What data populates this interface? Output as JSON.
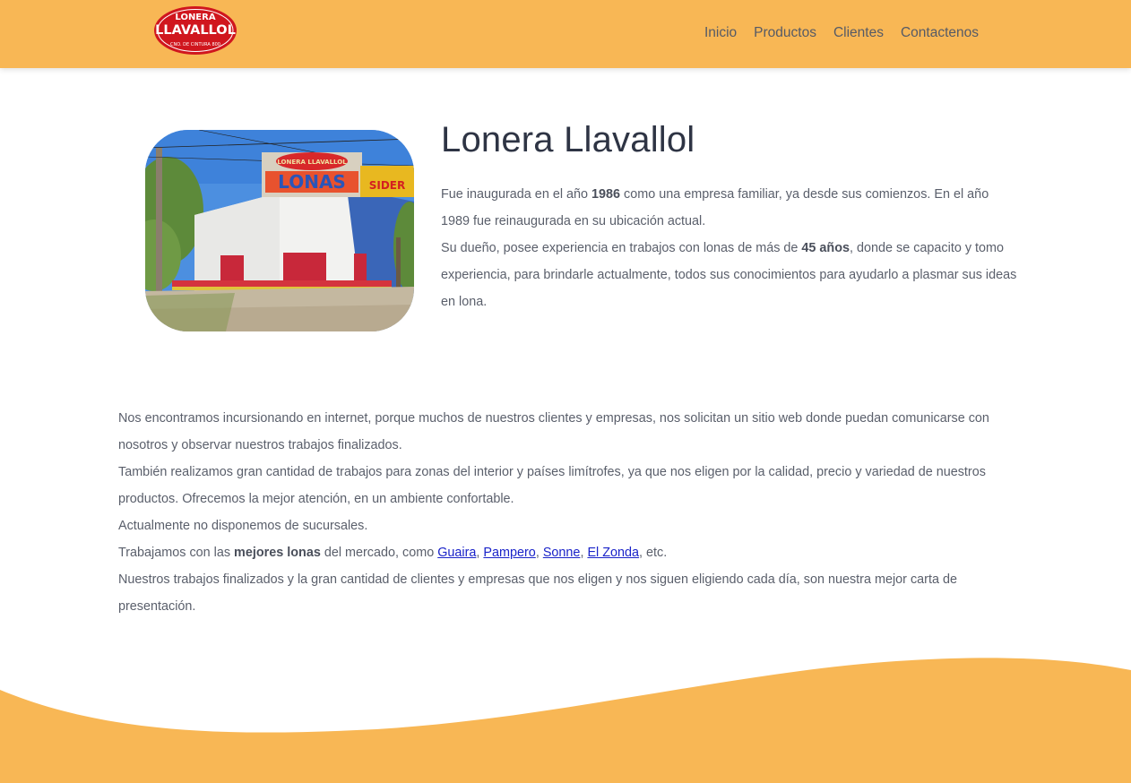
{
  "logo": {
    "line1": "LONERA",
    "line2": "LLAVALLOL",
    "line3": "CNO. DE CINTURA 800"
  },
  "nav": {
    "items": [
      "Inicio",
      "Productos",
      "Clientes",
      "Contactenos"
    ]
  },
  "photo": {
    "sign_text": "LONAS",
    "sign_top_text": "LONERA LLAVALLOL",
    "side_text": "SIDER"
  },
  "about": {
    "title": "Lonera Llavallol",
    "p1_a": "Fue inaugurada en el año ",
    "p1_b": "1986",
    "p1_c": " como una empresa familiar, ya desde sus comienzos. En el año 1989 fue reinaugurada en su ubicación actual.",
    "p2_a": "Su dueño, posee experiencia en trabajos con lonas de más de ",
    "p2_b": "45 años",
    "p2_c": ", donde se capacito y tomo experiencia, para brindarle actualmente, todos sus conocimientos para ayudarlo a plasmar sus ideas en lona."
  },
  "content": {
    "p1": "Nos encontramos incursionando en internet, porque muchos de nuestros clientes y empresas, nos solicitan un sitio web donde puedan comunicarse con nosotros y observar nuestros trabajos finalizados.",
    "p2": "También realizamos gran cantidad de trabajos para zonas del interior y países limítrofes, ya que nos eligen por la calidad, precio y variedad de nuestros productos. Ofrecemos la mejor atención, en un ambiente confortable.",
    "p3": "Actualmente no disponemos de sucursales.",
    "p4_a": "Trabajamos con las ",
    "p4_b": "mejores lonas",
    "p4_c": " del mercado, como ",
    "brands": [
      "Guaira",
      "Pampero",
      "Sonne",
      "El Zonda"
    ],
    "sep": ", ",
    "p4_end": ", etc.",
    "p5": "Nuestros trabajos finalizados y la gran cantidad de clientes y empresas que nos eligen y nos siguen eligiendo cada día, son nuestra mejor carta de presentación."
  },
  "colors": {
    "header": "#f8b755",
    "wave": "#f8b755",
    "link": "#1a23c9",
    "logo_red": "#d0161e"
  }
}
